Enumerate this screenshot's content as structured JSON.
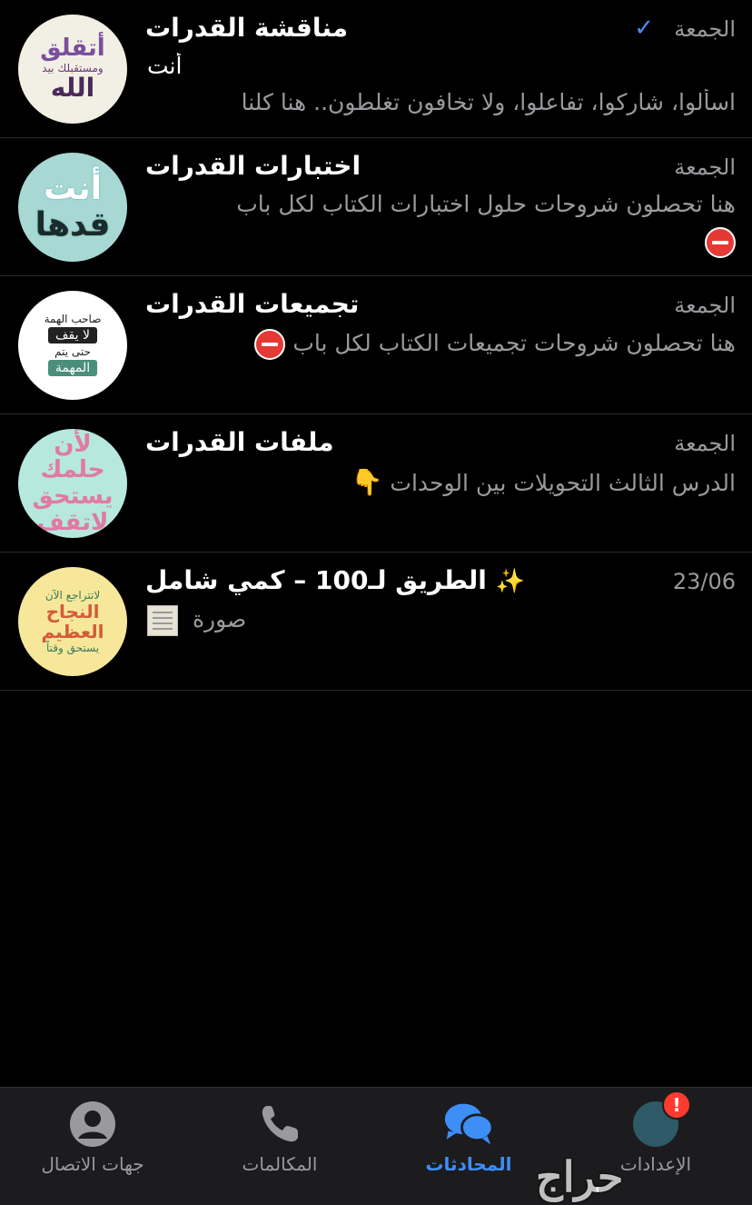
{
  "chats": [
    {
      "title": "مناقشة القدرات",
      "time": "الجمعة",
      "sender": "أنت",
      "preview": "اسألوا، شاركوا، تفاعلوا، ولا تخافون تغلطون.. هنا كلنا",
      "avatar_lines": [
        "أتقلق",
        "ومستقبلك بيد",
        "الله"
      ]
    },
    {
      "title": "اختبارات القدرات",
      "time": "الجمعة",
      "preview": "هنا تحصلون شروحات حلول اختبارات الكتاب لكل باب",
      "avatar_lines": [
        "أنت",
        "قدها"
      ]
    },
    {
      "title": "تجميعات القدرات",
      "time": "الجمعة",
      "preview": "هنا تحصلون شروحات تجميعات الكتاب لكل باب",
      "avatar_lines": [
        "صاحب الهمة",
        "لا يقف",
        "حتى يتم",
        "المهمة"
      ]
    },
    {
      "title": "ملفات القدرات",
      "time": "الجمعة",
      "preview": "الدرس الثالث التحويلات بين الوحدات",
      "avatar_lines": [
        "لأن حلمك",
        "يستحق",
        "لاتقف"
      ]
    },
    {
      "title": "الطريق لـ100 – كمي شامل",
      "time": "23/06",
      "preview": "صورة",
      "avatar_lines": [
        "لاتتراجع الآن",
        "النجاح العظيم",
        "يستحق وقتاً"
      ]
    }
  ],
  "tabs": {
    "contacts": "جهات الاتصال",
    "calls": "المكالمات",
    "chats": "المحادثات",
    "settings": "الإعدادات"
  },
  "settings_badge": "!",
  "watermark": "حراج",
  "colors": {
    "background": "#000000",
    "accent": "#3e8ef7",
    "secondary_text": "#9a9a9e",
    "tab_bar": "#1c1c1e",
    "badge": "#ff3b30"
  }
}
